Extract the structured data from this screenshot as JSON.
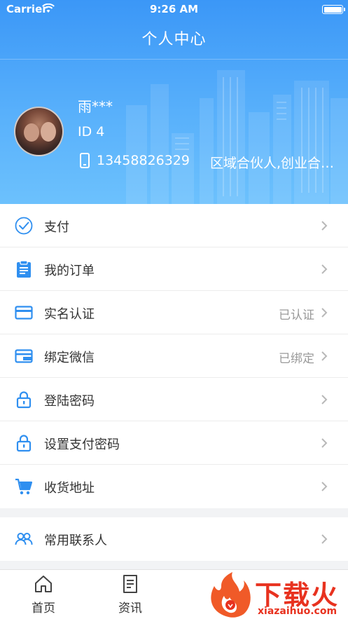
{
  "status_bar": {
    "carrier": "Carrier",
    "time": "9:26 AM"
  },
  "header": {
    "title": "个人中心"
  },
  "profile": {
    "name": "雨***",
    "id": "ID 4",
    "phone": "13458826329",
    "roles": "区域合伙人,创业合伙人"
  },
  "menu": {
    "group1": [
      {
        "label": "支付",
        "value": "",
        "icon": "check-circle-icon"
      },
      {
        "label": "我的订单",
        "value": "",
        "icon": "clipboard-icon"
      },
      {
        "label": "实名认证",
        "value": "已认证",
        "icon": "card-icon"
      },
      {
        "label": "绑定微信",
        "value": "已绑定",
        "icon": "wallet-icon"
      },
      {
        "label": "登陆密码",
        "value": "",
        "icon": "lock-icon"
      },
      {
        "label": "设置支付密码",
        "value": "",
        "icon": "lock-icon"
      },
      {
        "label": "收货地址",
        "value": "",
        "icon": "cart-icon"
      }
    ],
    "group2": [
      {
        "label": "常用联系人",
        "value": "",
        "icon": "contacts-icon"
      }
    ]
  },
  "tab_bar": [
    {
      "label": "首页",
      "icon": "home-icon"
    },
    {
      "label": "资讯",
      "icon": "document-icon"
    }
  ],
  "watermark": {
    "text": "下载火",
    "url": "xiazaihuo.com"
  },
  "colors": {
    "accent": "#2f8ff0",
    "header_top": "#3b97f7",
    "header_bottom": "#6cc1fd",
    "watermark": "#e8321f"
  }
}
